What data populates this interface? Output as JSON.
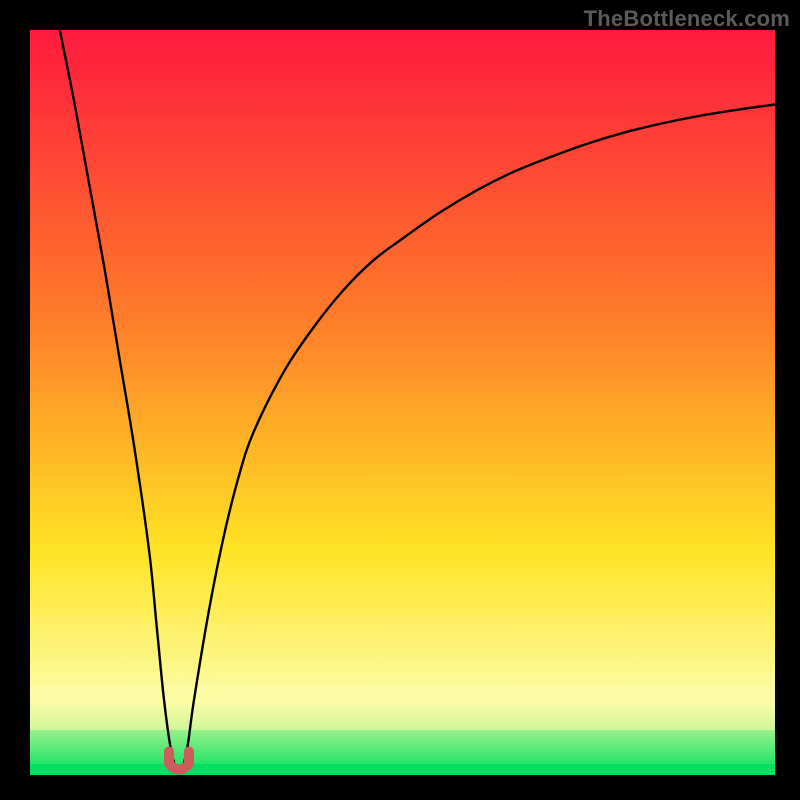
{
  "watermark": "TheBottleneck.com",
  "chart_data": {
    "type": "line",
    "title": "",
    "xlabel": "",
    "ylabel": "",
    "xlim": [
      0,
      100
    ],
    "ylim": [
      0,
      100
    ],
    "gradient": {
      "top_color": "#ff1a3e",
      "mid1_color": "#ff7a2a",
      "mid2_color": "#ffe424",
      "band_color": "#fdfca6",
      "bottom_color": "#00e060"
    },
    "series": [
      {
        "name": "bottleneck-curve",
        "x": [
          4,
          6,
          8,
          10,
          12,
          14,
          16,
          17,
          18,
          19,
          20,
          21,
          22,
          24,
          26,
          28,
          30,
          34,
          38,
          42,
          46,
          50,
          55,
          60,
          65,
          70,
          75,
          80,
          85,
          90,
          95,
          100
        ],
        "y": [
          100,
          90,
          79,
          68,
          56,
          44,
          30,
          20,
          10,
          3,
          0.5,
          3,
          10,
          22,
          32,
          40,
          46,
          54,
          60,
          65,
          69,
          72,
          75.5,
          78.5,
          81,
          83,
          84.8,
          86.3,
          87.5,
          88.5,
          89.3,
          90
        ]
      }
    ],
    "marker": {
      "name": "v-marker",
      "x": 20,
      "y": 1,
      "color": "#cc5d5d"
    }
  }
}
